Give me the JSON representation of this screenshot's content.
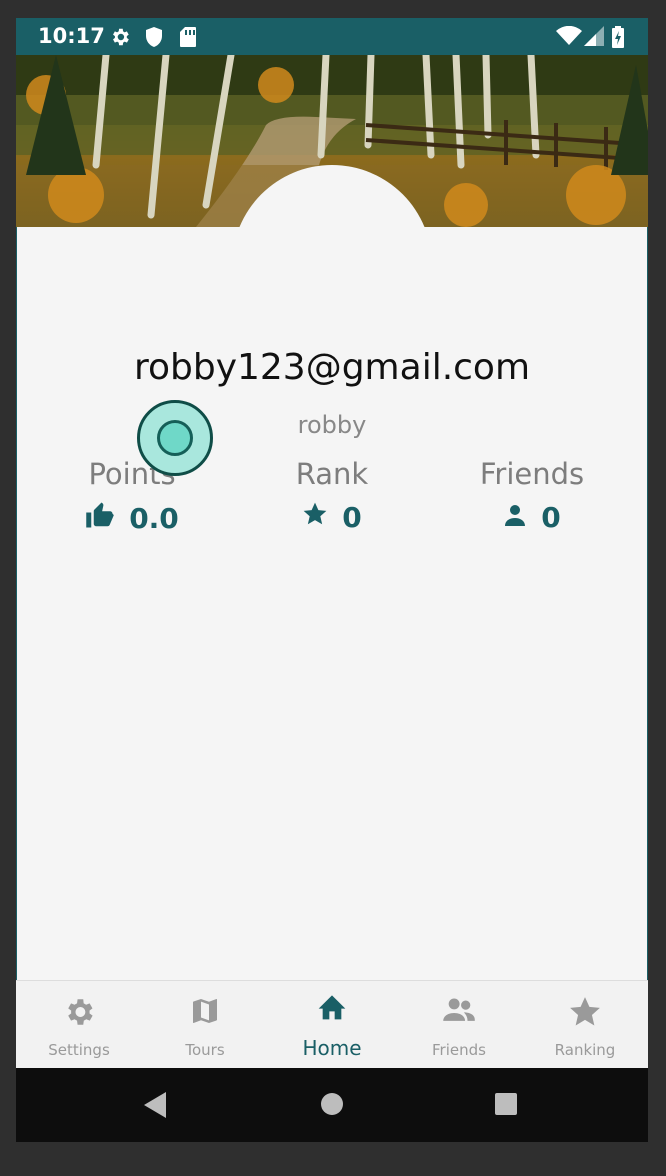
{
  "status_bar": {
    "time": "10:17",
    "icons": [
      "settings-icon",
      "shield-icon",
      "sd-card-icon",
      "wifi-icon",
      "signal-icon",
      "battery-charging-icon"
    ]
  },
  "profile": {
    "email": "robby123@gmail.com",
    "username": "robby"
  },
  "stats": [
    {
      "label": "Points",
      "value": "0.0",
      "icon": "thumbs-up-icon"
    },
    {
      "label": "Rank",
      "value": "0",
      "icon": "star-icon"
    },
    {
      "label": "Friends",
      "value": "0",
      "icon": "person-icon"
    }
  ],
  "bottom_nav": {
    "items": [
      {
        "label": "Settings",
        "icon": "gear-icon",
        "active": false
      },
      {
        "label": "Tours",
        "icon": "map-icon",
        "active": false
      },
      {
        "label": "Home",
        "icon": "home-icon",
        "active": true
      },
      {
        "label": "Friends",
        "icon": "people-icon",
        "active": false
      },
      {
        "label": "Ranking",
        "icon": "star-icon",
        "active": false
      }
    ]
  },
  "colors": {
    "primary": "#1a5f66",
    "background": "#f5f5f5",
    "inactive": "#9a9a9a",
    "fab": "#a9e7dd"
  }
}
